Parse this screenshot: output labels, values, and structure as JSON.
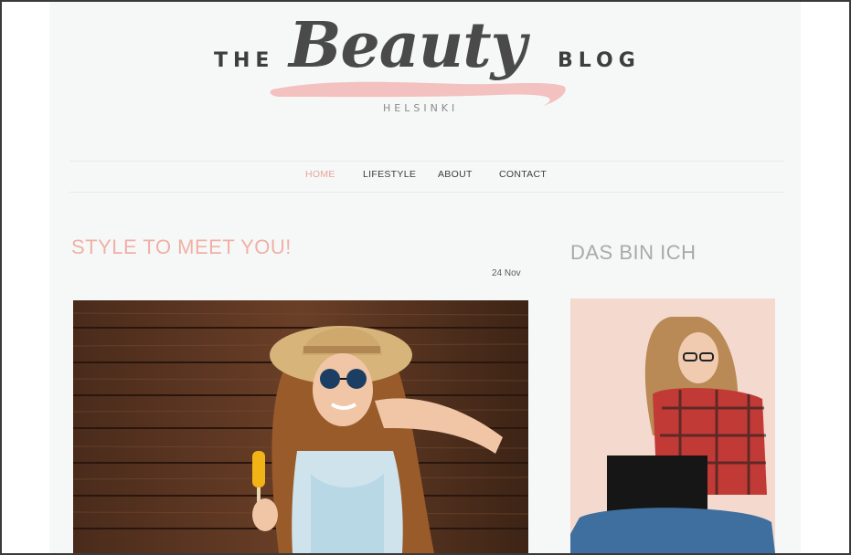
{
  "header": {
    "logo_the": "THE",
    "logo_beauty": "Beauty",
    "logo_blog": "BLOG",
    "logo_city": "HELSINKI"
  },
  "nav": {
    "items": [
      {
        "label": "HOME",
        "active": true
      },
      {
        "label": "LIFESTYLE",
        "active": false
      },
      {
        "label": "ABOUT",
        "active": false
      },
      {
        "label": "CONTACT",
        "active": false
      }
    ]
  },
  "post": {
    "title": "STYLE TO MEET YOU!",
    "date": "24 Nov",
    "image": "woman-with-sunglasses-and-popsicle-photo"
  },
  "sidebar": {
    "title": "DAS BIN ICH",
    "image": "woman-with-laptop-photo"
  },
  "colors": {
    "accent": "#f0b0a6",
    "swash": "#f2b7b5",
    "page_bg": "#f6f8f8",
    "text": "#3e3e3e"
  }
}
